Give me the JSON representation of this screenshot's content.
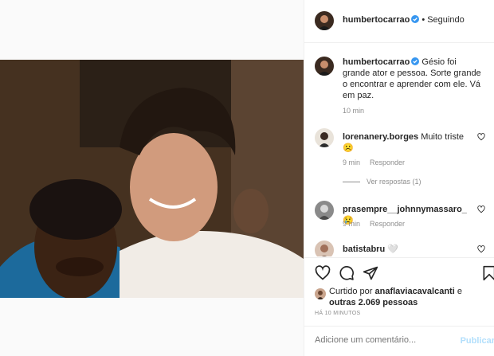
{
  "post": {
    "photo_alt": "",
    "author": {
      "username": "humbertocarrao",
      "follow_status": "Seguindo",
      "separator": "•"
    },
    "caption": {
      "username": "humbertocarrao",
      "text": "Gésio foi grande ator e pessoa. Sorte grande o encontrar e aprender com ele. Vá em paz.",
      "time": "10 min"
    },
    "comments": [
      {
        "username": "lorenanery.borges",
        "text": "Muito triste ☹️",
        "time": "9 min",
        "reply_label": "Responder",
        "view_replies": "Ver respostas (1)"
      },
      {
        "username": "prasempre__johnnymassaro_",
        "text": "😢",
        "time": "9 min",
        "reply_label": "Responder"
      },
      {
        "username": "batistabru",
        "text": "🤍"
      }
    ],
    "likes": {
      "text_prefix": "Curtido por ",
      "liker": "anaflaviacavalcanti",
      "text_middle": " e ",
      "others": "outras 2.069 pessoas"
    },
    "time_ago": "HÁ 10 MINUTOS",
    "comment_input": {
      "placeholder": "Adicione um comentário...",
      "value": ""
    },
    "publish_label": "Publicar"
  },
  "colors": {
    "verified": "#3897f0",
    "muted": "#8e8e8e",
    "publish_disabled": "#b2dffc",
    "border": "#efefef"
  },
  "icons": [
    "verified-badge-icon",
    "heart-icon",
    "comment-icon",
    "share-icon",
    "bookmark-icon"
  ]
}
